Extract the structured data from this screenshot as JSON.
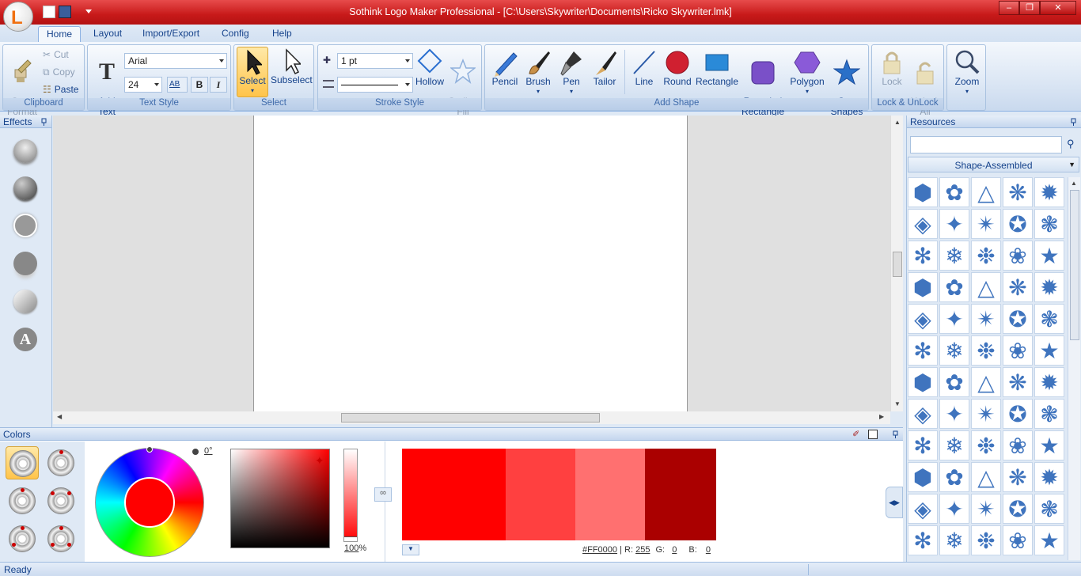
{
  "window": {
    "title": "Sothink Logo Maker Professional - [C:\\Users\\Skywriter\\Documents\\Ricko Skywriter.lmk]",
    "app_letter": "L"
  },
  "tabs": [
    {
      "label": "Home",
      "active": true
    },
    {
      "label": "Layout"
    },
    {
      "label": "Import/Export"
    },
    {
      "label": "Config"
    },
    {
      "label": "Help"
    }
  ],
  "ribbon": {
    "clipboard": {
      "label": "Clipboard",
      "copy_format": "Copy\nFormat",
      "cut": "Cut",
      "copy": "Copy",
      "paste": "Paste"
    },
    "text_style": {
      "label": "Text Style",
      "add_text": "Add\nText",
      "font": "Arial",
      "size": "24",
      "bold": "B",
      "italic": "I",
      "ab": "AB"
    },
    "select": {
      "label": "Select",
      "select": "Select",
      "subselect": "Subselect"
    },
    "stroke_style": {
      "label": "Stroke Style",
      "width": "1 pt",
      "hollow": "Hollow",
      "outline_fill": "Outline\nFill"
    },
    "add_shape": {
      "label": "Add Shape",
      "pencil": "Pencil",
      "brush": "Brush",
      "pen": "Pen",
      "tailor": "Tailor",
      "line": "Line",
      "round": "Round",
      "rectangle": "Rectangle",
      "rounded_rectangle": "Rounded\nRectangle",
      "polygon": "Polygon",
      "star_shapes": "Star\nShapes"
    },
    "lock": {
      "label": "Lock & UnLock",
      "lock": "Lock",
      "unlock_all": "Unlock\nAll"
    },
    "zoom": {
      "label": "Zoom"
    }
  },
  "effects": {
    "title": "Effects",
    "text_glyph": "A"
  },
  "colors": {
    "title": "Colors",
    "angle": "0°",
    "opacity": "100",
    "opacity_unit": "%",
    "hex": "#FF0000",
    "r_label": "R:",
    "r": "255",
    "g_label": "G:",
    "g": "0",
    "b_label": "B:",
    "b": "0",
    "sep": "|",
    "swatches": [
      "#ff0000",
      "#ff4040",
      "#ff7070",
      "#aa0000"
    ],
    "current": "#ff0000"
  },
  "resources": {
    "title": "Resources",
    "search_value": "",
    "category": "Shape-Assembled"
  },
  "status": {
    "text": "Ready"
  }
}
